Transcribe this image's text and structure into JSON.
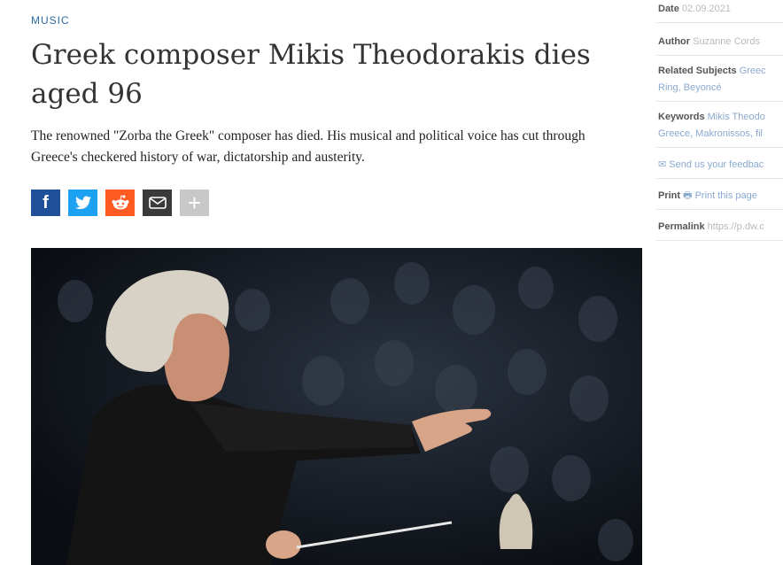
{
  "article": {
    "category": "MUSIC",
    "headline": "Greek composer Mikis Theodorakis dies aged 96",
    "lead": "The renowned \"Zorba the Greek\" composer has died. His musical and political voice has cut through Greece's checkered history of war, dictatorship and austerity."
  },
  "share": {
    "buttons": [
      {
        "icon": "facebook-icon",
        "glyph": "f",
        "color": "#1f4f99"
      },
      {
        "icon": "twitter-icon",
        "glyph": "🐦",
        "color": "#1da1f2"
      },
      {
        "icon": "reddit-icon",
        "glyph": "👽",
        "color": "#ff5a1f"
      },
      {
        "icon": "email-icon",
        "glyph": "✉",
        "color": "#3a3a3a"
      },
      {
        "icon": "more-icon",
        "glyph": "+",
        "color": "#c8c8c8"
      }
    ]
  },
  "sidebar": {
    "date_label": "Date",
    "date_value": "02.09.2021",
    "author_label": "Author",
    "author_value": "Suzanne Cords",
    "related_label": "Related Subjects",
    "related_value": "Greec",
    "related_value2": "Ring, Beyoncé",
    "keywords_label": "Keywords",
    "keywords_value": "Mikis Theodo",
    "keywords_value2": "Greece, Makronissos, fil",
    "feedback": "Send us your feedbac",
    "print_label": "Print",
    "print_link": "Print this page",
    "permalink_label": "Permalink",
    "permalink_value": "https://p.dw.c"
  }
}
